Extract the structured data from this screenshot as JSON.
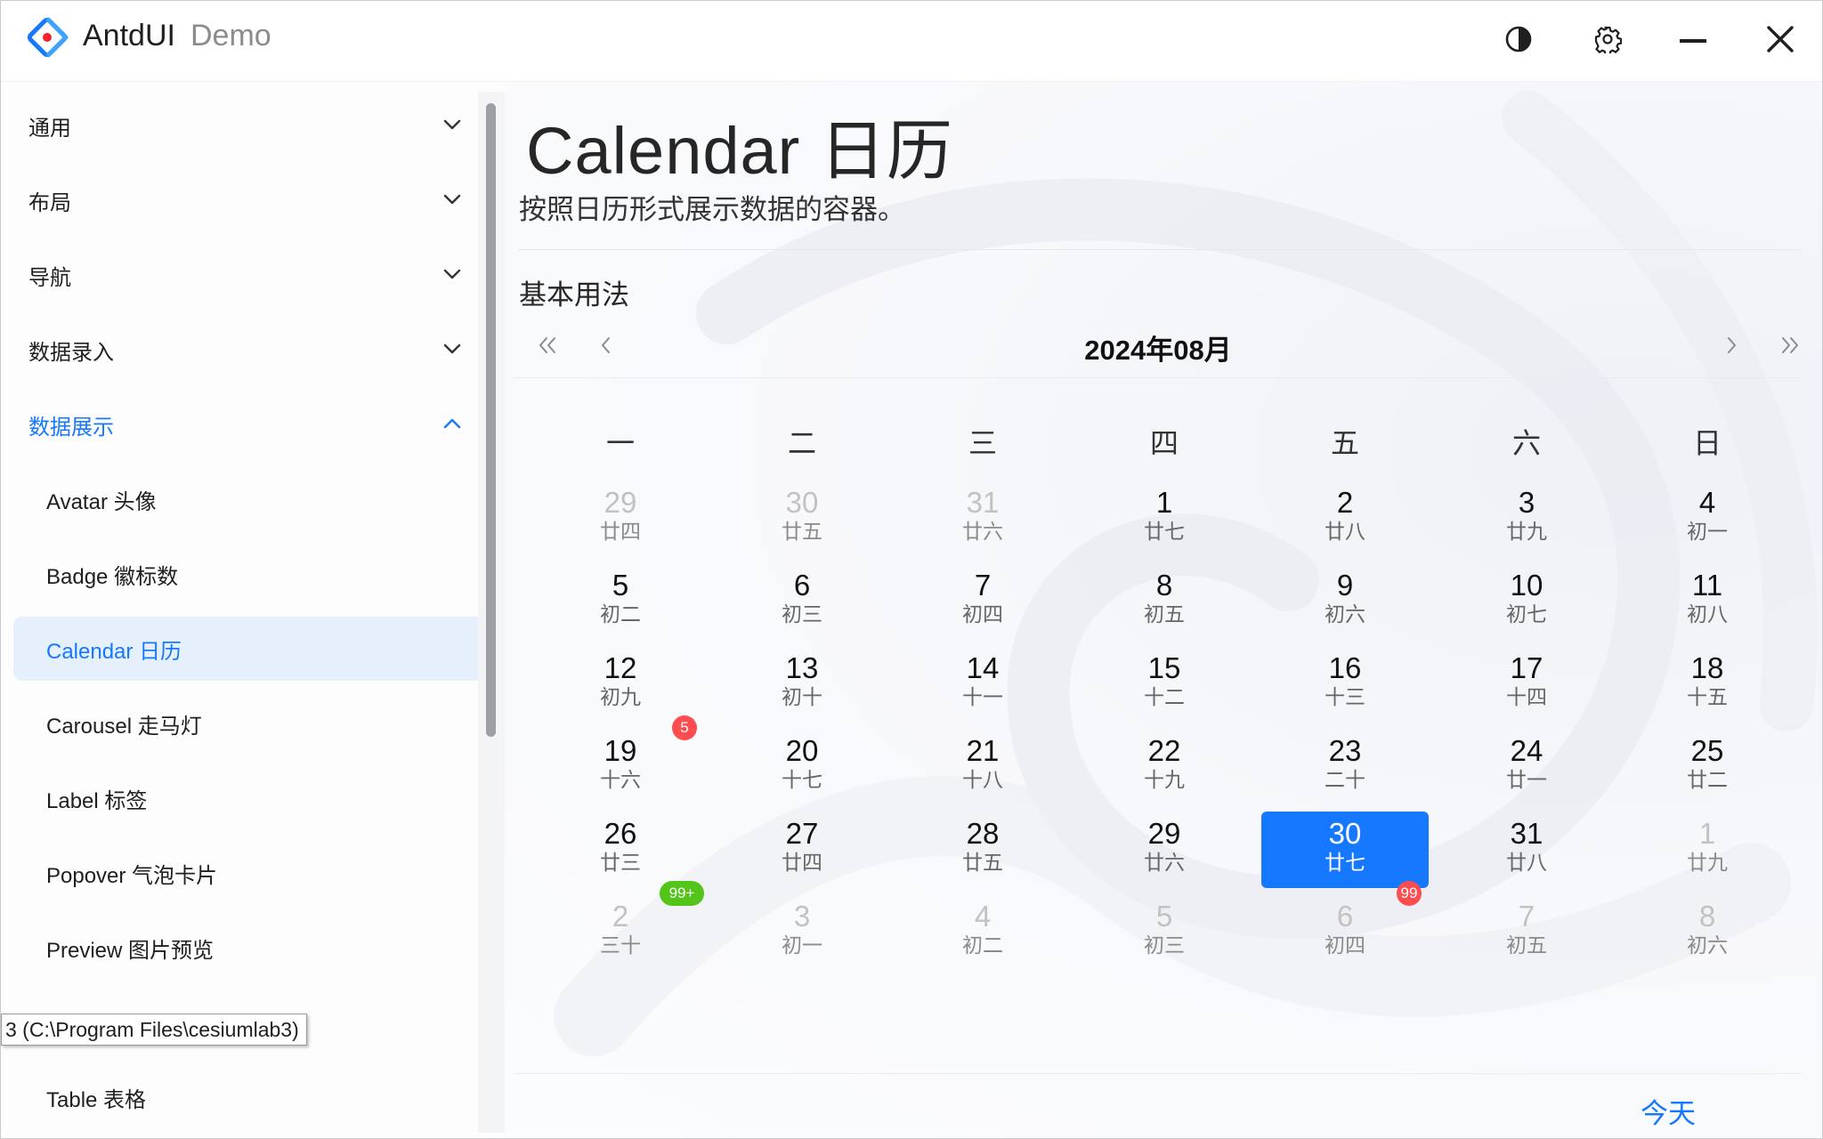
{
  "app": {
    "title": "AntdUI",
    "subtitle": "Demo"
  },
  "titlebar": {
    "icons": [
      "theme-toggle-icon",
      "gear-icon",
      "minimize-icon",
      "close-icon"
    ]
  },
  "sidebar": {
    "groups": [
      {
        "label": "通用",
        "expanded": false
      },
      {
        "label": "布局",
        "expanded": false
      },
      {
        "label": "导航",
        "expanded": false
      },
      {
        "label": "数据录入",
        "expanded": false
      },
      {
        "label": "数据展示",
        "expanded": true
      }
    ],
    "children": [
      {
        "label": "Avatar 头像"
      },
      {
        "label": "Badge 徽标数"
      },
      {
        "label": "Calendar 日历",
        "active": true
      },
      {
        "label": "Carousel 走马灯"
      },
      {
        "label": "Label 标签"
      },
      {
        "label": "Popover 气泡卡片"
      },
      {
        "label": "Preview 图片预览"
      },
      {
        "label": "Table 表格"
      }
    ]
  },
  "tooltip": {
    "text": "3 (C:\\Program Files\\cesiumlab3)"
  },
  "page": {
    "title": "Calendar 日历",
    "description": "按照日历形式展示数据的容器。",
    "section_title": "基本用法"
  },
  "calendar": {
    "month_label": "2024年08月",
    "weekdays": [
      "一",
      "二",
      "三",
      "四",
      "五",
      "六",
      "日"
    ],
    "weeks": [
      [
        {
          "day": "29",
          "lunar": "廿四",
          "muted": true
        },
        {
          "day": "30",
          "lunar": "廿五",
          "muted": true
        },
        {
          "day": "31",
          "lunar": "廿六",
          "muted": true
        },
        {
          "day": "1",
          "lunar": "廿七"
        },
        {
          "day": "2",
          "lunar": "廿八"
        },
        {
          "day": "3",
          "lunar": "廿九"
        },
        {
          "day": "4",
          "lunar": "初一"
        }
      ],
      [
        {
          "day": "5",
          "lunar": "初二"
        },
        {
          "day": "6",
          "lunar": "初三"
        },
        {
          "day": "7",
          "lunar": "初四"
        },
        {
          "day": "8",
          "lunar": "初五"
        },
        {
          "day": "9",
          "lunar": "初六"
        },
        {
          "day": "10",
          "lunar": "初七"
        },
        {
          "day": "11",
          "lunar": "初八"
        }
      ],
      [
        {
          "day": "12",
          "lunar": "初九",
          "badge": "5",
          "badge_color": "#ff4d4f"
        },
        {
          "day": "13",
          "lunar": "初十"
        },
        {
          "day": "14",
          "lunar": "十一"
        },
        {
          "day": "15",
          "lunar": "十二"
        },
        {
          "day": "16",
          "lunar": "十三"
        },
        {
          "day": "17",
          "lunar": "十四"
        },
        {
          "day": "18",
          "lunar": "十五"
        }
      ],
      [
        {
          "day": "19",
          "lunar": "十六"
        },
        {
          "day": "20",
          "lunar": "十七"
        },
        {
          "day": "21",
          "lunar": "十八"
        },
        {
          "day": "22",
          "lunar": "十九"
        },
        {
          "day": "23",
          "lunar": "二十"
        },
        {
          "day": "24",
          "lunar": "廿一"
        },
        {
          "day": "25",
          "lunar": "廿二"
        }
      ],
      [
        {
          "day": "26",
          "lunar": "廿三",
          "badge": "99+",
          "badge_color": "#52c41a"
        },
        {
          "day": "27",
          "lunar": "廿四"
        },
        {
          "day": "28",
          "lunar": "廿五"
        },
        {
          "day": "29",
          "lunar": "廿六"
        },
        {
          "day": "30",
          "lunar": "廿七",
          "selected": true,
          "badge": "99",
          "badge_color": "#ff4d4f"
        },
        {
          "day": "31",
          "lunar": "廿八"
        },
        {
          "day": "1",
          "lunar": "廿九",
          "muted": true
        }
      ],
      [
        {
          "day": "2",
          "lunar": "三十",
          "muted": true
        },
        {
          "day": "3",
          "lunar": "初一",
          "muted": true
        },
        {
          "day": "4",
          "lunar": "初二",
          "muted": true
        },
        {
          "day": "5",
          "lunar": "初三",
          "muted": true
        },
        {
          "day": "6",
          "lunar": "初四",
          "muted": true
        },
        {
          "day": "7",
          "lunar": "初五",
          "muted": true
        },
        {
          "day": "8",
          "lunar": "初六",
          "muted": true
        }
      ]
    ],
    "today_label": "今天"
  },
  "colors": {
    "accent": "#1677ff",
    "badge_red": "#ff4d4f",
    "badge_green": "#52c41a"
  }
}
